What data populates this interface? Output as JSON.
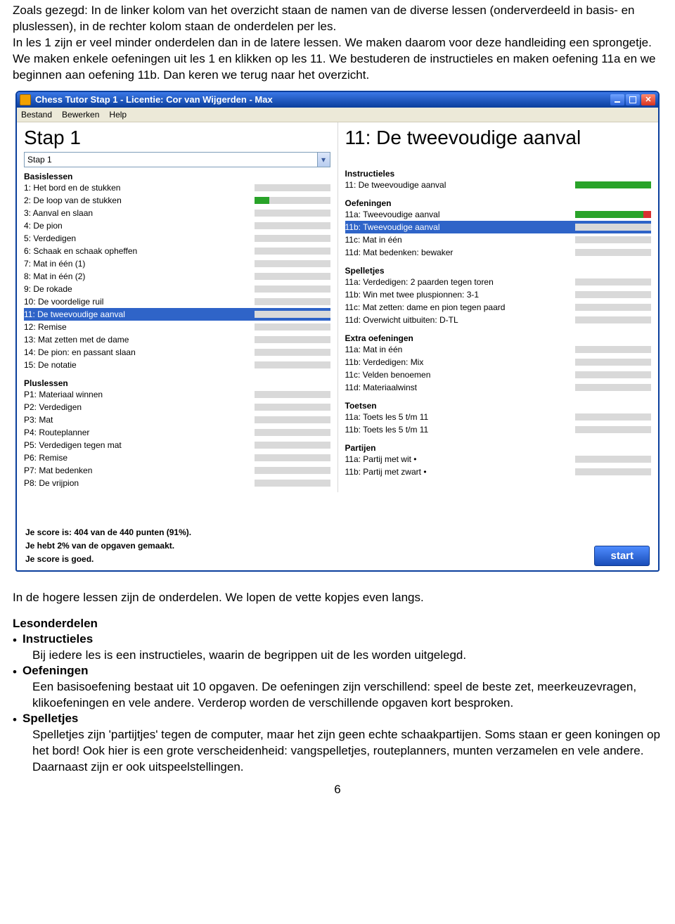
{
  "intro": {
    "p1": "Zoals gezegd: In de linker kolom van het overzicht staan de namen van de diverse lessen (onderverdeeld in basis- en pluslessen), in de rechter kolom staan de onderdelen per les.",
    "p2": "In les 1 zijn er veel minder onderdelen dan in de latere lessen. We maken daarom voor deze handleiding een sprongetje. We maken enkele oefeningen uit les 1 en klikken op les 11. We bestuderen de instructieles en maken oefening 11a en we beginnen aan oefening 11b. Dan keren we terug naar het overzicht."
  },
  "window": {
    "title": "Chess Tutor Stap 1 - Licentie: Cor van Wijgerden - Max",
    "min_tip": "Minimize",
    "max_tip": "Maximize",
    "close_tip": "Close"
  },
  "menu": {
    "file": "Bestand",
    "edit": "Bewerken",
    "help": "Help"
  },
  "left": {
    "heading": "Stap 1",
    "dropdown": "Stap 1",
    "basis_head": "Basislessen",
    "basis": [
      {
        "label": "1: Het bord en de stukken",
        "g": 0,
        "r": 0
      },
      {
        "label": "2: De loop van de stukken",
        "g": 20,
        "r": 0
      },
      {
        "label": "3: Aanval en slaan",
        "g": 0,
        "r": 0
      },
      {
        "label": "4: De pion",
        "g": 0,
        "r": 0
      },
      {
        "label": "5: Verdedigen",
        "g": 0,
        "r": 0
      },
      {
        "label": "6: Schaak en schaak opheffen",
        "g": 0,
        "r": 0
      },
      {
        "label": "7: Mat in één (1)",
        "g": 0,
        "r": 0
      },
      {
        "label": "8: Mat in één (2)",
        "g": 0,
        "r": 0
      },
      {
        "label": "9: De rokade",
        "g": 0,
        "r": 0
      },
      {
        "label": "10: De voordelige ruil",
        "g": 0,
        "r": 0
      },
      {
        "label": "11: De tweevoudige aanval",
        "g": 0,
        "r": 0,
        "selected": true
      },
      {
        "label": "12: Remise",
        "g": 0,
        "r": 0
      },
      {
        "label": "13: Mat zetten met de dame",
        "g": 0,
        "r": 0
      },
      {
        "label": "14: De pion: en passant slaan",
        "g": 0,
        "r": 0
      },
      {
        "label": "15: De notatie",
        "g": 0,
        "r": 0
      }
    ],
    "plus_head": "Pluslessen",
    "plus": [
      {
        "label": "P1: Materiaal winnen",
        "g": 0,
        "r": 0
      },
      {
        "label": "P2: Verdedigen",
        "g": 0,
        "r": 0
      },
      {
        "label": "P3: Mat",
        "g": 0,
        "r": 0
      },
      {
        "label": "P4: Routeplanner",
        "g": 0,
        "r": 0
      },
      {
        "label": "P5: Verdedigen tegen mat",
        "g": 0,
        "r": 0
      },
      {
        "label": "P6: Remise",
        "g": 0,
        "r": 0
      },
      {
        "label": "P7: Mat bedenken",
        "g": 0,
        "r": 0
      },
      {
        "label": "P8: De vrijpion",
        "g": 0,
        "r": 0
      }
    ]
  },
  "right": {
    "heading": "11: De tweevoudige aanval",
    "instr_head": "Instructieles",
    "instr": [
      {
        "label": "11: De tweevoudige aanval",
        "g": 100,
        "r": 0
      }
    ],
    "oef_head": "Oefeningen",
    "oef": [
      {
        "label": "11a: Tweevoudige aanval",
        "g": 90,
        "r": 10
      },
      {
        "label": "11b: Tweevoudige aanval",
        "g": 0,
        "r": 0,
        "selected": true
      },
      {
        "label": "11c: Mat in één",
        "g": 0,
        "r": 0
      },
      {
        "label": "11d: Mat bedenken: bewaker",
        "g": 0,
        "r": 0
      }
    ],
    "spel_head": "Spelletjes",
    "spel": [
      {
        "label": "11a: Verdedigen: 2 paarden tegen toren",
        "g": 0,
        "r": 0
      },
      {
        "label": "11b: Win met twee pluspionnen: 3-1",
        "g": 0,
        "r": 0
      },
      {
        "label": "11c: Mat zetten: dame en pion tegen paard",
        "g": 0,
        "r": 0
      },
      {
        "label": "11d: Overwicht uitbuiten: D-TL",
        "g": 0,
        "r": 0
      }
    ],
    "extra_head": "Extra oefeningen",
    "extra": [
      {
        "label": "11a: Mat in één",
        "g": 0,
        "r": 0
      },
      {
        "label": "11b: Verdedigen: Mix",
        "g": 0,
        "r": 0
      },
      {
        "label": "11c: Velden benoemen",
        "g": 0,
        "r": 0
      },
      {
        "label": "11d: Materiaalwinst",
        "g": 0,
        "r": 0
      }
    ],
    "toets_head": "Toetsen",
    "toets": [
      {
        "label": "11a: Toets les 5 t/m 11",
        "g": 0,
        "r": 0
      },
      {
        "label": "11b: Toets les 5 t/m 11",
        "g": 0,
        "r": 0
      }
    ],
    "partij_head": "Partijen",
    "partij": [
      {
        "label": "11a: Partij met wit •",
        "g": 0,
        "r": 0
      },
      {
        "label": "11b: Partij met zwart •",
        "g": 0,
        "r": 0
      }
    ]
  },
  "footer": {
    "score": "Je score is: 404 van de 440 punten (91%).",
    "progress": "Je hebt 2% van de opgaven gemaakt.",
    "rating": "Je score is goed.",
    "start": "start"
  },
  "after": {
    "p1": "In de hogere lessen zijn de onderdelen. We lopen de vette kopjes even langs.",
    "heading": "Lesonderdelen",
    "b1_head": "Instructieles",
    "b1_text": "Bij iedere les is een instructieles, waarin de begrippen uit de les worden uitgelegd.",
    "b2_head": "Oefeningen",
    "b2_text": "Een basisoefening bestaat uit 10 opgaven. De oefeningen zijn verschillend: speel de beste zet, meerkeuzevragen, klikoefeningen en vele andere. Verderop worden de verschillende opgaven kort besproken.",
    "b3_head": "Spelletjes",
    "b3_text": "Spelletjes zijn 'partijtjes' tegen de computer, maar het zijn geen echte schaakpartijen. Soms staan er geen koningen op het bord! Ook hier is een grote verscheidenheid: vangspelletjes, routeplanners, munten verzamelen en vele andere. Daarnaast zijn er ook uitspeelstellingen."
  },
  "page_number": "6"
}
